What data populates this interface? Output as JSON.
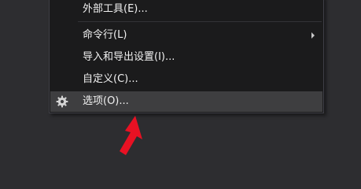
{
  "menu": {
    "items": [
      {
        "label": "外部工具(E)..."
      },
      {
        "label": "命令行(L)"
      },
      {
        "label": "导入和导出设置(I)..."
      },
      {
        "label": "自定义(C)..."
      },
      {
        "label": "选项(O)..."
      }
    ]
  },
  "icons": {
    "options": "gear-icon",
    "submenu": "chevron-right-icon",
    "pointer": "red-arrow-annotation-icon"
  },
  "colors": {
    "background": "#2d2d30",
    "menu_background": "#1b1b1c",
    "menu_border": "#3f3f46",
    "hover_background": "#3e3e40",
    "text": "#f1f1f1",
    "arrow": "#e81123"
  }
}
